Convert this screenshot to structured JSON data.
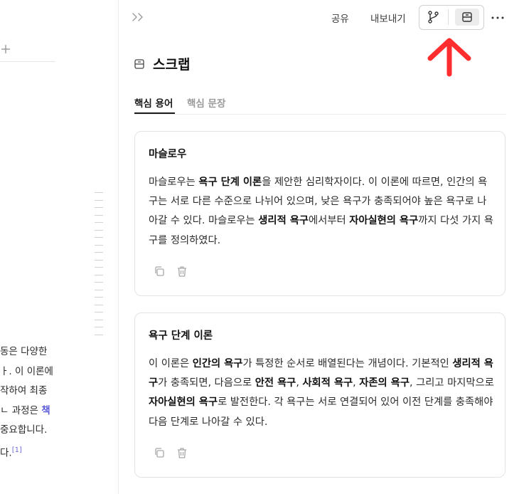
{
  "left_pane": {
    "lines": [
      {
        "text": "동은 다양한"
      },
      {
        "text": "ㅏ. 이 이론에"
      },
      {
        "text": "작하여 최종"
      },
      {
        "text": "ㄴ 과정은 ",
        "highlight": "책"
      },
      {
        "text": "중요합니다."
      },
      {
        "text": "다.",
        "footnote": "[1]"
      }
    ]
  },
  "toolbar": {
    "share_label": "공유",
    "export_label": "내보내기"
  },
  "panel": {
    "title": "스크랩",
    "tabs": [
      {
        "label": "핵심 용어",
        "active": true
      },
      {
        "label": "핵심 문장",
        "active": false
      }
    ]
  },
  "cards": [
    {
      "title": "마슬로우",
      "body": [
        {
          "t": "마슬로우는 "
        },
        {
          "t": "욕구 단계 이론",
          "b": true
        },
        {
          "t": "을 제안한 심리학자이다. 이 이론에 따르면, 인간의 욕구는 서로 다른 수준으로 나뉘어 있으며, 낮은 욕구가 충족되어야 높은 욕구로 나아갈 수 있다. 마슬로우는 "
        },
        {
          "t": "생리적 욕구",
          "b": true
        },
        {
          "t": "에서부터 "
        },
        {
          "t": "자아실현의 욕구",
          "b": true
        },
        {
          "t": "까지 다섯 가지 욕구를 정의하였다."
        }
      ]
    },
    {
      "title": "욕구 단계 이론",
      "body": [
        {
          "t": "이 이론은 "
        },
        {
          "t": "인간의 욕구",
          "b": true
        },
        {
          "t": "가 특정한 순서로 배열된다는 개념이다. 기본적인 "
        },
        {
          "t": "생리적 욕구",
          "b": true
        },
        {
          "t": "가 충족되면, 다음으로 "
        },
        {
          "t": "안전 욕구",
          "b": true
        },
        {
          "t": ", "
        },
        {
          "t": "사회적 욕구",
          "b": true
        },
        {
          "t": ", "
        },
        {
          "t": "자존의 욕구",
          "b": true
        },
        {
          "t": ", 그리고 마지막으로 "
        },
        {
          "t": "자아실현의 욕구",
          "b": true
        },
        {
          "t": "로 발전한다. 각 욕구는 서로 연결되어 있어 이전 단계를 충족해야 다음 단계로 나아갈 수 있다."
        }
      ]
    }
  ],
  "icons": {
    "expand": "double-chevron-right-icon",
    "branch": "git-branch-icon",
    "scrap": "scrap-icon",
    "more": "more-horizontal-icon",
    "copy": "copy-icon",
    "trash": "trash-icon",
    "plus": "plus-icon",
    "annotation_arrow": "red-up-arrow"
  },
  "colors": {
    "accent_arrow": "#ff2d2d",
    "link": "#5a5ad8",
    "active_tab": "#1a1a1a",
    "inactive_tab": "#9a9a9a"
  }
}
